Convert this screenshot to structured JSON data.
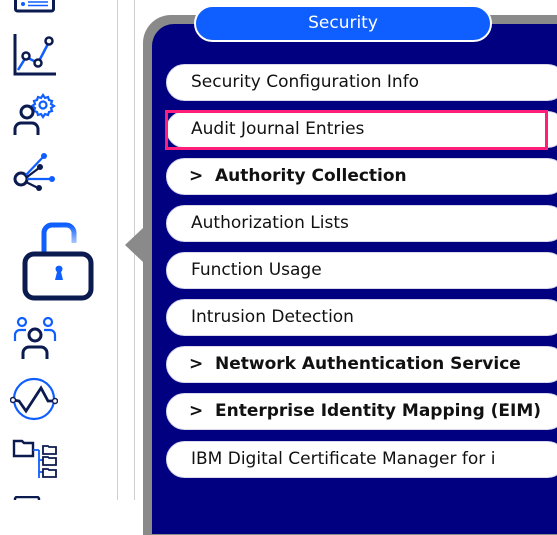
{
  "sidebar": {
    "icons": [
      {
        "name": "server-list-icon"
      },
      {
        "name": "line-chart-icon"
      },
      {
        "name": "user-settings-icon"
      },
      {
        "name": "network-node-icon"
      },
      {
        "name": "unlocked-padlock-icon",
        "active": true
      },
      {
        "name": "user-group-icon"
      },
      {
        "name": "performance-gauge-icon"
      },
      {
        "name": "folder-tree-icon"
      }
    ]
  },
  "panel": {
    "title": "Security",
    "items": [
      {
        "label": "Security Configuration Info",
        "expandable": false
      },
      {
        "label": "Audit Journal Entries",
        "expandable": false,
        "highlighted": true
      },
      {
        "label": "Authority Collection",
        "expandable": true
      },
      {
        "label": "Authorization Lists",
        "expandable": false
      },
      {
        "label": "Function Usage",
        "expandable": false
      },
      {
        "label": "Intrusion Detection",
        "expandable": false
      },
      {
        "label": "Network Authentication Service",
        "expandable": true
      },
      {
        "label": "Enterprise Identity Mapping (EIM)",
        "expandable": true
      },
      {
        "label": "IBM Digital Certificate Manager for i",
        "expandable": false
      }
    ],
    "chevron_glyph": ">"
  },
  "colors": {
    "panel_bg": "#000080",
    "title_bg": "#0f5eff",
    "highlight": "#ff1f7a",
    "icon_dark": "#0b1a4f",
    "icon_accent": "#0f5eff"
  }
}
